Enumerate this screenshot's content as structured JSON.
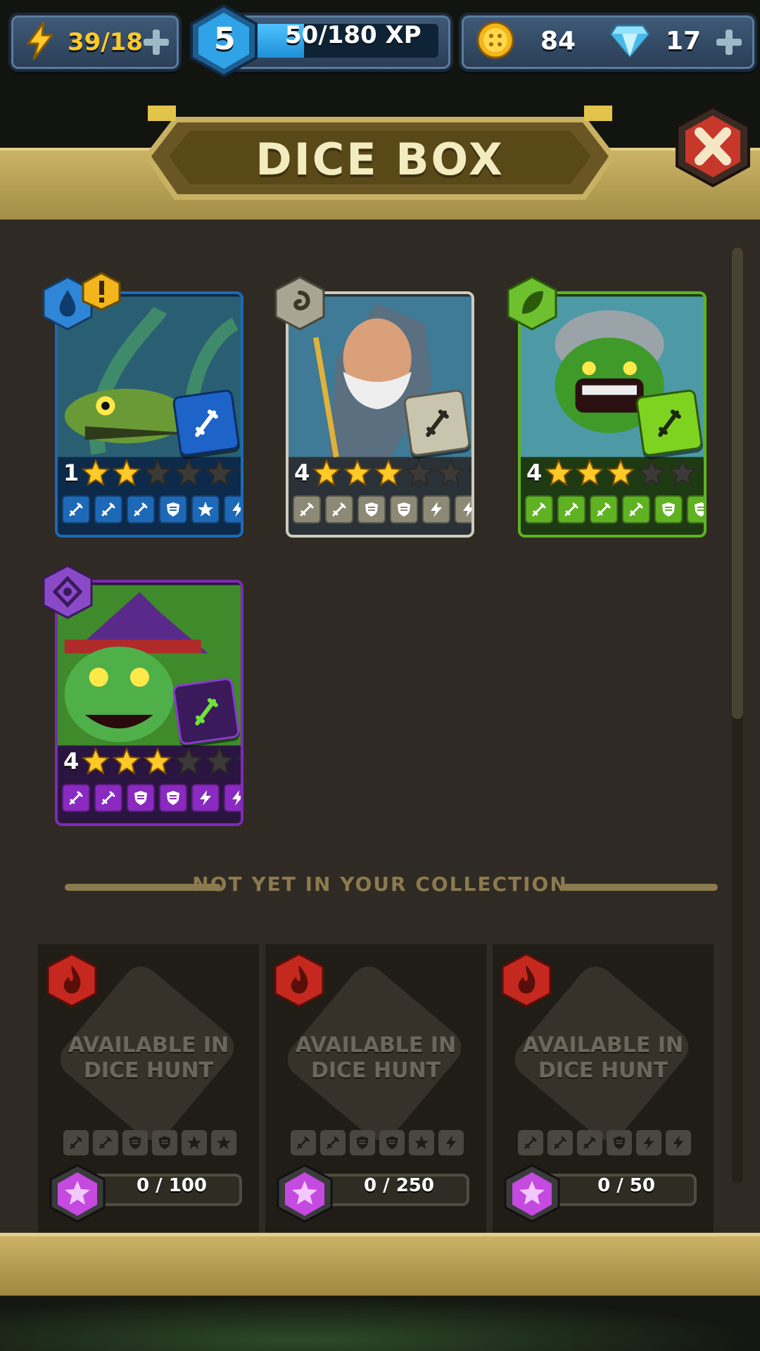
{
  "hud": {
    "energy": "39/18",
    "level": "5",
    "xp": "50/180 XP",
    "xp_progress": 0.28,
    "coins": "84",
    "gems": "17"
  },
  "title": "DICE BOX",
  "owned_dice": [
    {
      "level": "1",
      "stars": 2,
      "element": "water",
      "color": "#1d69b8"
    },
    {
      "level": "4",
      "stars": 3,
      "element": "air",
      "color": "#8c8a76"
    },
    {
      "level": "4",
      "stars": 3,
      "element": "nature",
      "color": "#5fb322"
    },
    {
      "level": "4",
      "stars": 3,
      "element": "arcane",
      "color": "#7d2ab5"
    }
  ],
  "divider": "NOT YET IN YOUR COLLECTION",
  "locked_dice": [
    {
      "text_line1": "AVAILABLE IN",
      "text_line2": "DICE HUNT",
      "shards": "0 / 100"
    },
    {
      "text_line1": "AVAILABLE IN",
      "text_line2": "DICE HUNT",
      "shards": "0 / 250"
    },
    {
      "text_line1": "AVAILABLE IN",
      "text_line2": "DICE HUNT",
      "shards": "0 / 50"
    }
  ]
}
